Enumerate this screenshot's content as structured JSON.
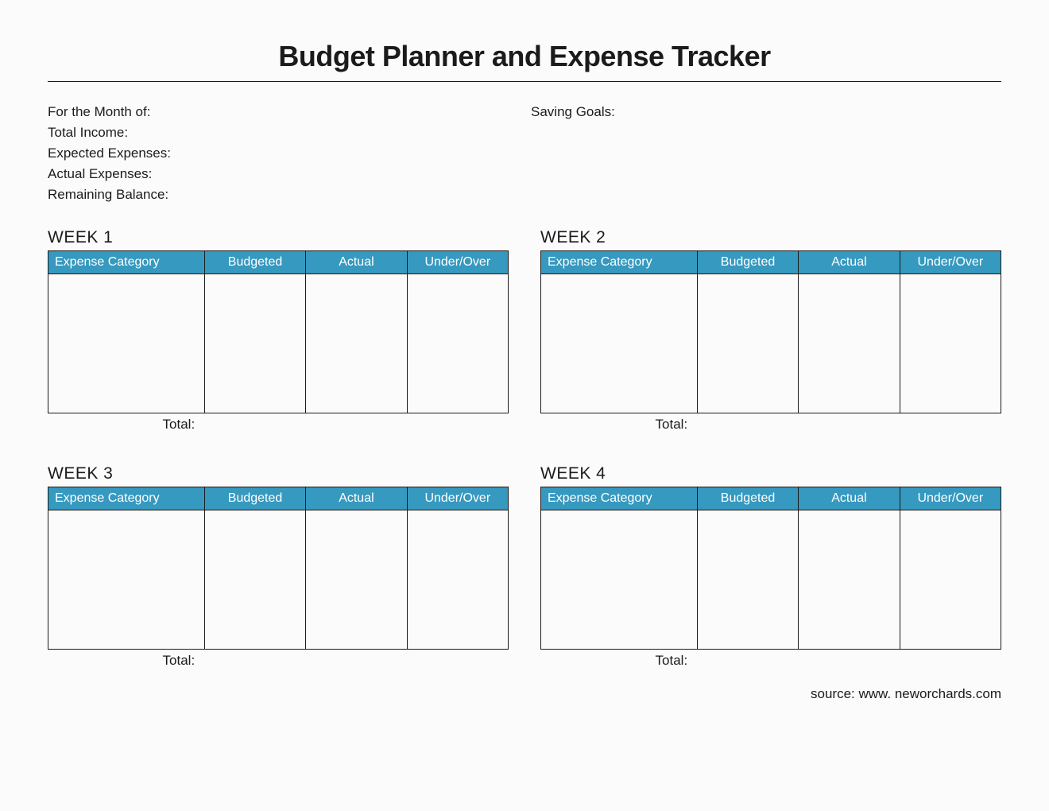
{
  "title": "Budget Planner and Expense Tracker",
  "meta": {
    "month_label": "For the Month of:",
    "income_label": "Total Income:",
    "expected_label": "Expected Expenses:",
    "actual_label": "Actual Expenses:",
    "remaining_label": "Remaining Balance:",
    "saving_label": "Saving Goals:"
  },
  "table_headers": {
    "category": "Expense Category",
    "budgeted": "Budgeted",
    "actual": "Actual",
    "under_over": "Under/Over"
  },
  "weeks": [
    {
      "title": "WEEK 1",
      "total_label": "Total:"
    },
    {
      "title": "WEEK 2",
      "total_label": "Total:"
    },
    {
      "title": "WEEK 3",
      "total_label": "Total:"
    },
    {
      "title": "WEEK 4",
      "total_label": "Total:"
    }
  ],
  "footer": "source: www. neworchards.com"
}
